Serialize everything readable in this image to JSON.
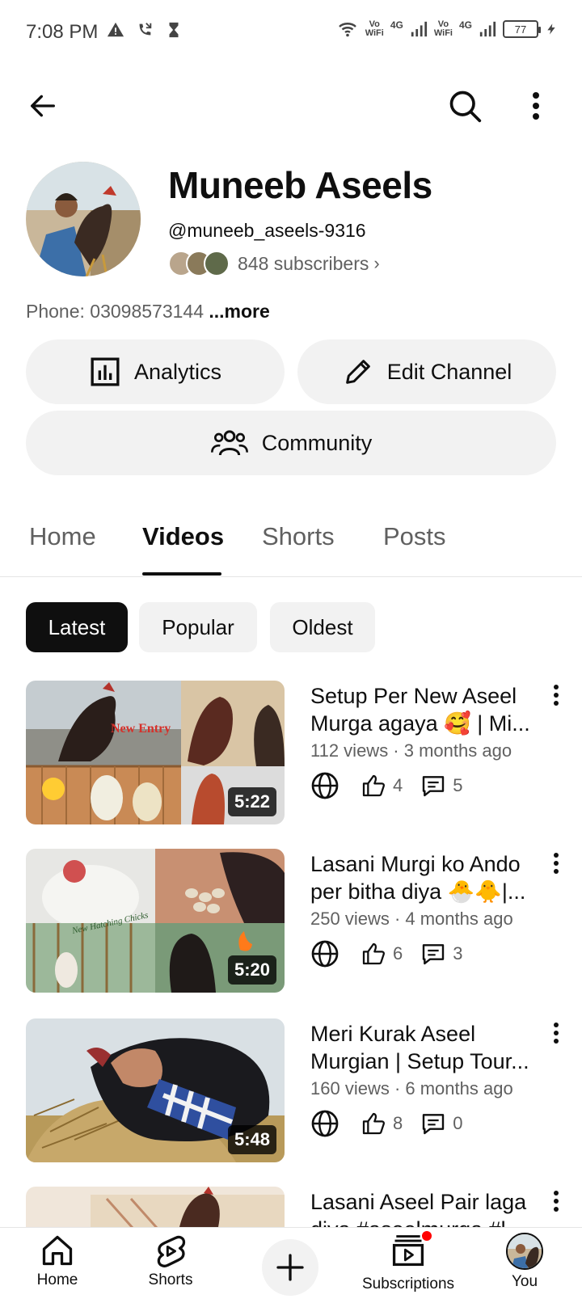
{
  "status_bar": {
    "time": "7:08 PM",
    "battery": "77",
    "network_1": "4G",
    "network_2": "4G",
    "vowifi_1": "Vo\nWiFi",
    "vowifi_2": "Vo\nWiFi"
  },
  "channel": {
    "name": "Muneeb Aseels",
    "handle": "@muneeb_aseels-9316",
    "subscribers": "848 subscribers",
    "description": "Phone: 03098573144",
    "more_label": "...more"
  },
  "actions": {
    "analytics": "Analytics",
    "edit_channel": "Edit Channel",
    "community": "Community"
  },
  "tabs": [
    {
      "label": "Home",
      "active": false
    },
    {
      "label": "Videos",
      "active": true
    },
    {
      "label": "Shorts",
      "active": false
    },
    {
      "label": "Posts",
      "active": false
    }
  ],
  "chips": [
    {
      "label": "Latest",
      "active": true
    },
    {
      "label": "Popular",
      "active": false
    },
    {
      "label": "Oldest",
      "active": false
    }
  ],
  "videos": [
    {
      "title": "Setup Per New Aseel Murga agaya 🥰 | Mi...",
      "meta": "112 views · 3 months ago",
      "likes": "4",
      "comments": "5",
      "duration": "5:22",
      "overlay_text": "New Entry"
    },
    {
      "title": "Lasani Murgi ko Ando per bitha diya 🐣🐥|...",
      "meta": "250 views · 4 months ago",
      "likes": "6",
      "comments": "3",
      "duration": "5:20",
      "overlay_text": "New Hatching Chicks"
    },
    {
      "title": "Meri Kurak Aseel Murgian | Setup Tour...",
      "meta": "160 views · 6 months ago",
      "likes": "8",
      "comments": "0",
      "duration": "5:48"
    },
    {
      "title": "Lasani Aseel Pair laga diya #aseelmurga #l...",
      "meta": "",
      "likes": "",
      "comments": "",
      "duration": ""
    }
  ],
  "bottom_nav": {
    "home": "Home",
    "shorts": "Shorts",
    "subscriptions": "Subscriptions",
    "you": "You"
  },
  "colors": {
    "text_primary": "#0f0f0f",
    "text_secondary": "#606060",
    "chip_bg": "#f2f2f2",
    "notification": "#ff0000"
  }
}
